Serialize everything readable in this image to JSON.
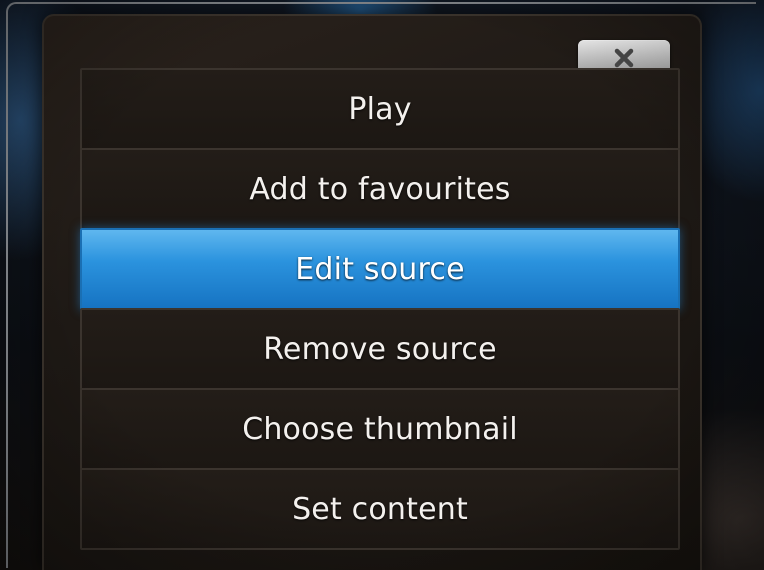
{
  "dialog": {
    "close_icon": "close-icon",
    "menu": {
      "items": [
        {
          "label": "Play",
          "selected": false
        },
        {
          "label": "Add to favourites",
          "selected": false
        },
        {
          "label": "Edit source",
          "selected": true
        },
        {
          "label": "Remove source",
          "selected": false
        },
        {
          "label": "Choose thumbnail",
          "selected": false
        },
        {
          "label": "Set content",
          "selected": false
        }
      ]
    }
  },
  "colors": {
    "selection_blue": "#2b93de",
    "dialog_background": "#1e1915",
    "text": "#f4f1ee"
  }
}
